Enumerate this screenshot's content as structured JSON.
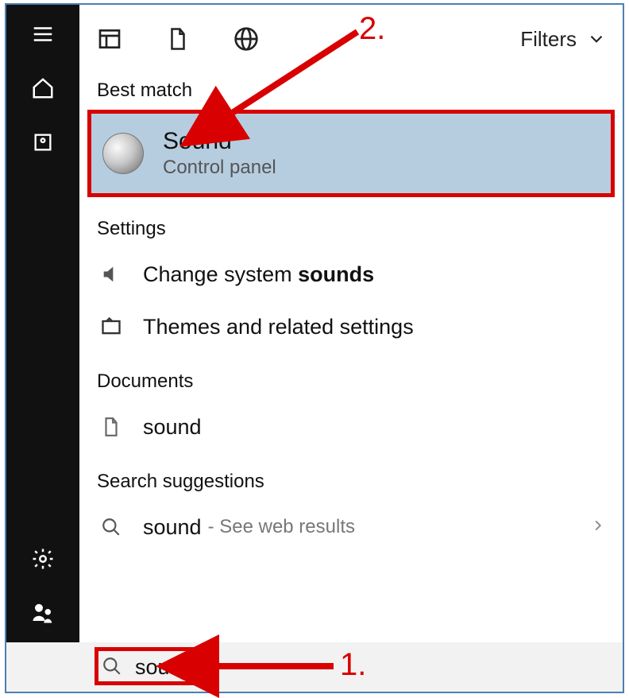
{
  "filters_label": "Filters",
  "sections": {
    "best_match": "Best match",
    "settings": "Settings",
    "documents": "Documents",
    "search_suggestions": "Search suggestions"
  },
  "best_match_item": {
    "title": "Sound",
    "subtitle": "Control panel"
  },
  "settings_items": [
    {
      "label_pre": "Change system ",
      "label_bold": "sounds"
    },
    {
      "label_pre": "Themes and related settings",
      "label_bold": ""
    }
  ],
  "documents_items": [
    {
      "label": "sound"
    }
  ],
  "suggestions": [
    {
      "label": "sound",
      "sub": "- See web results"
    }
  ],
  "search_value": "sound",
  "annotations": {
    "step1": "1.",
    "step2": "2."
  }
}
